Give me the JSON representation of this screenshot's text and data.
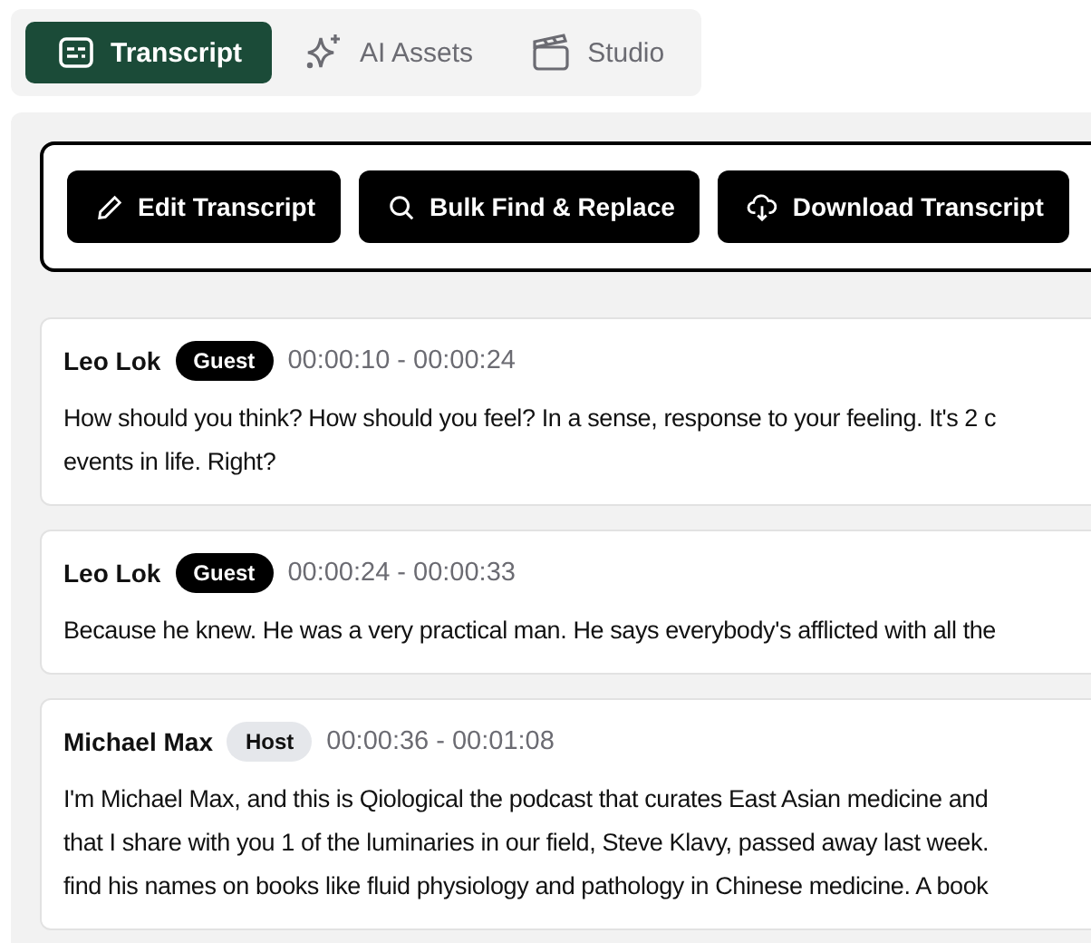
{
  "tabs": [
    {
      "label": "Transcript",
      "kind": "transcript",
      "selected": true
    },
    {
      "label": "AI Assets",
      "kind": "sparkle",
      "selected": false
    },
    {
      "label": "Studio",
      "kind": "clapper",
      "selected": false
    }
  ],
  "toolbar": [
    {
      "label": "Edit Transcript",
      "kind": "edit"
    },
    {
      "label": "Bulk Find & Replace",
      "kind": "search"
    },
    {
      "label": "Download Transcript",
      "kind": "download"
    }
  ],
  "segments": [
    {
      "speaker": "Leo Lok",
      "role": "Guest",
      "kind": "guest",
      "time": "00:00:10 - 00:00:24",
      "lines": [
        "How should you think? How should you feel? In a sense, response to your feeling. It's 2 c",
        "events in life. Right?"
      ]
    },
    {
      "speaker": "Leo Lok",
      "role": "Guest",
      "kind": "guest",
      "time": "00:00:24 - 00:00:33",
      "lines": [
        "Because he knew. He was a very practical man. He says everybody's afflicted with all the"
      ]
    },
    {
      "speaker": "Michael Max",
      "role": "Host",
      "kind": "host",
      "time": "00:00:36 - 00:01:08",
      "lines": [
        "I'm Michael Max, and this is Qiological the podcast that curates East Asian medicine and",
        "that I share with you 1 of the luminaries in our field, Steve Klavy, passed away last week.",
        "find his names on books like fluid physiology and pathology in Chinese medicine. A book"
      ]
    }
  ]
}
